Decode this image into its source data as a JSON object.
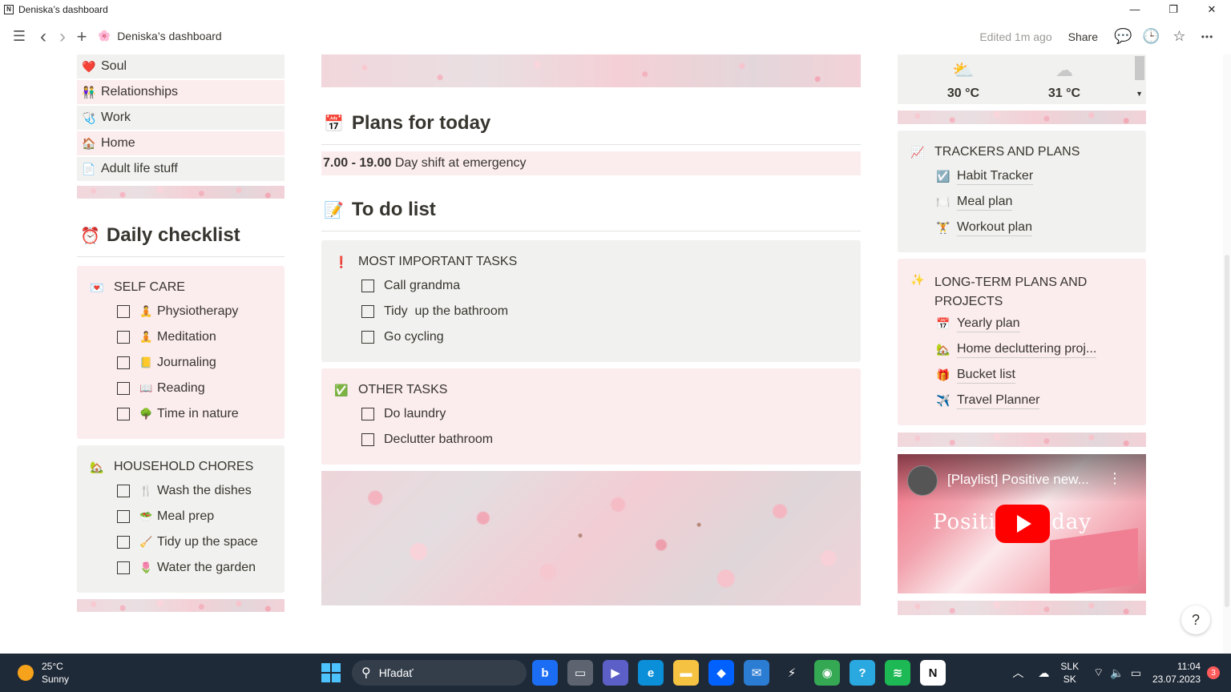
{
  "window": {
    "title": "Deniska’s dashboard",
    "minimize": "—",
    "restore": "❐",
    "close": "✕"
  },
  "toolbar": {
    "menu_icon": "☰",
    "back_icon": "‹",
    "forward_icon": "›",
    "new_icon": "+",
    "page_emoji": "🌸",
    "breadcrumb": "Deniska’s dashboard",
    "edited": "Edited 1m ago",
    "share": "Share",
    "comment_icon": "💬",
    "history_icon": "🕒",
    "star_icon": "☆",
    "more_icon": "•••"
  },
  "left_nav": {
    "items": [
      {
        "emoji": "❤️",
        "label": "Soul"
      },
      {
        "emoji": "👫",
        "label": "Relationships"
      },
      {
        "emoji": "🩺",
        "label": "Work"
      },
      {
        "emoji": "🏠",
        "label": "Home"
      },
      {
        "emoji": "📄",
        "label": "Adult life stuff"
      }
    ]
  },
  "daily_checklist": {
    "emoji": "⏰",
    "title": "Daily checklist",
    "self_care": {
      "emoji": "💌",
      "title": "SELF CARE",
      "items": [
        {
          "emoji": "🧘",
          "label": "Physiotherapy"
        },
        {
          "emoji": "🧘",
          "label": "Meditation"
        },
        {
          "emoji": "📒",
          "label": "Journaling"
        },
        {
          "emoji": "📖",
          "label": "Reading"
        },
        {
          "emoji": "🌳",
          "label": "Time in nature"
        }
      ]
    },
    "household": {
      "emoji": "🏡",
      "title": "HOUSEHOLD CHORES",
      "items": [
        {
          "emoji": "🍴",
          "label": "Wash the dishes"
        },
        {
          "emoji": "🥗",
          "label": "Meal prep"
        },
        {
          "emoji": "🧹",
          "label": "Tidy up the space"
        },
        {
          "emoji": "🌷",
          "label": "Water the garden"
        }
      ]
    }
  },
  "plans": {
    "emoji": "📅",
    "title": "Plans for today",
    "time": "7.00 - 19.00",
    "text": " Day shift at emergency"
  },
  "todo": {
    "emoji": "📝",
    "title": "To do list",
    "important": {
      "emoji": "❗",
      "title": "MOST IMPORTANT TASKS",
      "items": [
        "Call grandma",
        "Tidy  up the bathroom",
        "Go cycling"
      ]
    },
    "other": {
      "emoji": "✅",
      "title": "OTHER TASKS",
      "items": [
        "Do laundry",
        "Declutter bathroom"
      ]
    }
  },
  "weather": {
    "day1_icon": "⛅",
    "day1_temp": "30 °C",
    "day2_icon": "☁",
    "day2_temp": "31 °C"
  },
  "trackers": {
    "emoji": "📈",
    "title": "TRACKERS AND PLANS",
    "items": [
      {
        "emoji": "☑️",
        "label": "Habit Tracker"
      },
      {
        "emoji": "🍽️",
        "label": "Meal plan"
      },
      {
        "emoji": "🏋️",
        "label": "Workout plan"
      }
    ]
  },
  "longterm": {
    "emoji": "✨",
    "title_line1": "LONG-TERM PLANS AND",
    "title_line2": "PROJECTS",
    "items": [
      {
        "emoji": "📅",
        "label": "Yearly plan"
      },
      {
        "emoji": "🏡",
        "label": "Home decluttering proj..."
      },
      {
        "emoji": "🎁",
        "label": "Bucket list"
      },
      {
        "emoji": "✈️",
        "label": "Travel Planner"
      }
    ]
  },
  "video": {
    "title": "[Playlist] Positive new...",
    "overlay_text": "Positi    w day",
    "menu_icon": "⋮"
  },
  "help": "?",
  "taskbar": {
    "temp": "25°C",
    "condition": "Sunny",
    "search_placeholder": "Hľadať",
    "lang1": "SLK",
    "lang2": "SK",
    "time": "11:04",
    "date": "23.07.2023",
    "badge": "3",
    "apps": [
      {
        "name": "bing-icon",
        "glyph": "b",
        "bg": "#1b6ef3"
      },
      {
        "name": "files-icon",
        "glyph": "▭",
        "bg": "#5d6470"
      },
      {
        "name": "teams-icon",
        "glyph": "▶",
        "bg": "#5b5fc7"
      },
      {
        "name": "edge-icon",
        "glyph": "e",
        "bg": "#0a8fd8"
      },
      {
        "name": "explorer-icon",
        "glyph": "▬",
        "bg": "#f5c242"
      },
      {
        "name": "dropbox-icon",
        "glyph": "◆",
        "bg": "#0061fe"
      },
      {
        "name": "mail-icon",
        "glyph": "✉",
        "bg": "#2b7cd3"
      },
      {
        "name": "vscode-icon",
        "glyph": "⚡",
        "bg": "#1f2a38"
      },
      {
        "name": "chrome-icon",
        "glyph": "◉",
        "bg": "#34a853"
      },
      {
        "name": "settings-icon",
        "glyph": "?",
        "bg": "#2aa8e0"
      },
      {
        "name": "spotify-icon",
        "glyph": "≋",
        "bg": "#1db954"
      },
      {
        "name": "notion-icon",
        "glyph": "N",
        "bg": "#ffffff"
      }
    ]
  }
}
